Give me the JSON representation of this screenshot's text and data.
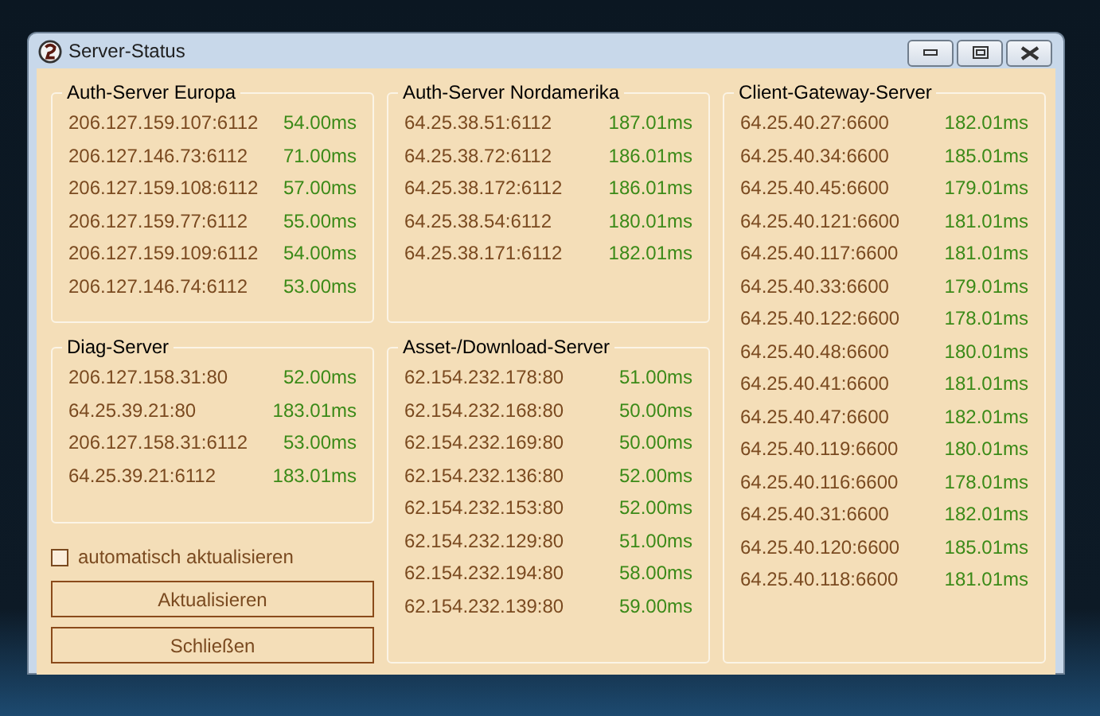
{
  "window": {
    "title": "Server-Status"
  },
  "columns": [
    {
      "groups": [
        {
          "title": "Auth-Server Europa",
          "servers": [
            {
              "address": "206.127.159.107:6112",
              "latency": "54.00ms"
            },
            {
              "address": "206.127.146.73:6112",
              "latency": "71.00ms"
            },
            {
              "address": "206.127.159.108:6112",
              "latency": "57.00ms"
            },
            {
              "address": "206.127.159.77:6112",
              "latency": "55.00ms"
            },
            {
              "address": "206.127.159.109:6112",
              "latency": "54.00ms"
            },
            {
              "address": "206.127.146.74:6112",
              "latency": "53.00ms"
            }
          ]
        },
        {
          "title": "Diag-Server",
          "servers": [
            {
              "address": "206.127.158.31:80",
              "latency": "52.00ms"
            },
            {
              "address": "64.25.39.21:80",
              "latency": "183.01ms"
            },
            {
              "address": "206.127.158.31:6112",
              "latency": "53.00ms"
            },
            {
              "address": "64.25.39.21:6112",
              "latency": "183.01ms"
            }
          ]
        }
      ]
    },
    {
      "groups": [
        {
          "title": "Auth-Server Nordamerika",
          "servers": [
            {
              "address": "64.25.38.51:6112",
              "latency": "187.01ms"
            },
            {
              "address": "64.25.38.72:6112",
              "latency": "186.01ms"
            },
            {
              "address": "64.25.38.172:6112",
              "latency": "186.01ms"
            },
            {
              "address": "64.25.38.54:6112",
              "latency": "180.01ms"
            },
            {
              "address": "64.25.38.171:6112",
              "latency": "182.01ms"
            }
          ]
        },
        {
          "title": "Asset-/Download-Server",
          "servers": [
            {
              "address": "62.154.232.178:80",
              "latency": "51.00ms"
            },
            {
              "address": "62.154.232.168:80",
              "latency": "50.00ms"
            },
            {
              "address": "62.154.232.169:80",
              "latency": "50.00ms"
            },
            {
              "address": "62.154.232.136:80",
              "latency": "52.00ms"
            },
            {
              "address": "62.154.232.153:80",
              "latency": "52.00ms"
            },
            {
              "address": "62.154.232.129:80",
              "latency": "51.00ms"
            },
            {
              "address": "62.154.232.194:80",
              "latency": "58.00ms"
            },
            {
              "address": "62.154.232.139:80",
              "latency": "59.00ms"
            }
          ]
        }
      ]
    },
    {
      "groups": [
        {
          "title": "Client-Gateway-Server",
          "servers": [
            {
              "address": "64.25.40.27:6600",
              "latency": "182.01ms"
            },
            {
              "address": "64.25.40.34:6600",
              "latency": "185.01ms"
            },
            {
              "address": "64.25.40.45:6600",
              "latency": "179.01ms"
            },
            {
              "address": "64.25.40.121:6600",
              "latency": "181.01ms"
            },
            {
              "address": "64.25.40.117:6600",
              "latency": "181.01ms"
            },
            {
              "address": "64.25.40.33:6600",
              "latency": "179.01ms"
            },
            {
              "address": "64.25.40.122:6600",
              "latency": "178.01ms"
            },
            {
              "address": "64.25.40.48:6600",
              "latency": "180.01ms"
            },
            {
              "address": "64.25.40.41:6600",
              "latency": "181.01ms"
            },
            {
              "address": "64.25.40.47:6600",
              "latency": "182.01ms"
            },
            {
              "address": "64.25.40.119:6600",
              "latency": "180.01ms"
            },
            {
              "address": "64.25.40.116:6600",
              "latency": "178.01ms"
            },
            {
              "address": "64.25.40.31:6600",
              "latency": "182.01ms"
            },
            {
              "address": "64.25.40.120:6600",
              "latency": "185.01ms"
            },
            {
              "address": "64.25.40.118:6600",
              "latency": "181.01ms"
            }
          ]
        }
      ]
    }
  ],
  "auto_refresh": {
    "label": "automatisch aktualisieren",
    "checked": false
  },
  "buttons": [
    "Aktualisieren",
    "Schließen"
  ]
}
